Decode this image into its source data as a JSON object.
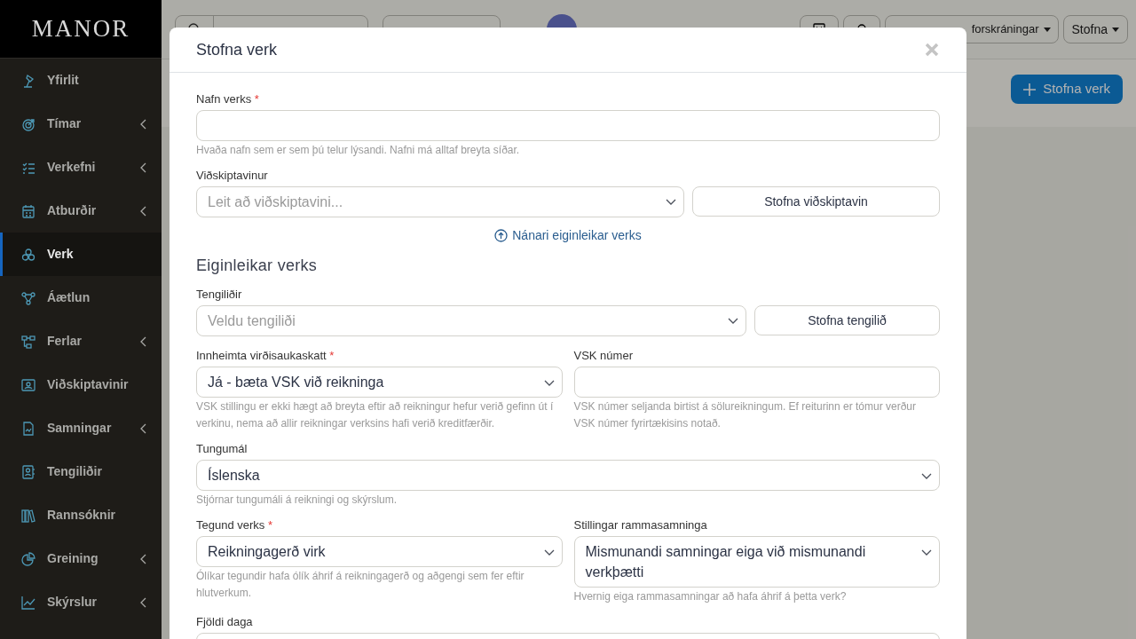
{
  "sidebar": {
    "logo": "MANOR",
    "items": [
      {
        "label": "Yfirlit",
        "selected": false,
        "expandable": false
      },
      {
        "label": "Tímar",
        "selected": false,
        "expandable": true
      },
      {
        "label": "Verkefni",
        "selected": false,
        "expandable": true
      },
      {
        "label": "Atburðir",
        "selected": false,
        "expandable": true
      },
      {
        "label": "Verk",
        "selected": true,
        "expandable": false
      },
      {
        "label": "Áætlun",
        "selected": false,
        "expandable": false
      },
      {
        "label": "Ferlar",
        "selected": false,
        "expandable": true
      },
      {
        "label": "Viðskiptavinir",
        "selected": false,
        "expandable": false
      },
      {
        "label": "Samningar",
        "selected": false,
        "expandable": true
      },
      {
        "label": "Tengiliðir",
        "selected": false,
        "expandable": false
      },
      {
        "label": "Rannsóknir",
        "selected": false,
        "expandable": false
      },
      {
        "label": "Greining",
        "selected": false,
        "expandable": true
      },
      {
        "label": "Skýrslur",
        "selected": false,
        "expandable": true
      }
    ]
  },
  "topbar": {
    "drafts_button": "forskráningar",
    "create_button": "Stofna"
  },
  "page": {
    "create_button": "Stofna verk"
  },
  "modal": {
    "title": "Stofna verk",
    "rows": [
      {
        "kind": "input",
        "label": "Nafn verks",
        "required_mark": "*",
        "help": "Hvaða nafn sem er sem þú telur lýsandi. Nafni má alltaf breyta síðar."
      },
      {
        "kind": "combo",
        "label": "Viðskiptavinur",
        "placeholder": "Leit að viðskiptavini...",
        "button": "Stofna viðskiptavin"
      },
      {
        "kind": "link",
        "text": "Nánari eiginleikar verks"
      },
      {
        "kind": "heading",
        "text": "Eiginleikar verks"
      },
      {
        "kind": "combo",
        "label": "Tengiliðir",
        "placeholder": "Veldu tengiliði",
        "button": "Stofna tengilið"
      },
      {
        "kind": "pair",
        "fields": [
          {
            "kind": "select",
            "label": "Innheimta virðisaukaskatt",
            "required_mark": "*",
            "value": "Já - bæta VSK við reikninga",
            "help": "VSK stillingu er ekki hægt að breyta eftir að reikningur hefur verið gefinn út í verkinu, nema að allir reikningar verksins hafi verið kreditfærðir."
          },
          {
            "kind": "input",
            "label": "VSK númer",
            "help": "VSK númer seljanda birtist á sölureikningum. Ef reiturinn er tómur verður VSK númer fyrirtækisins notað."
          }
        ]
      },
      {
        "kind": "select",
        "label": "Tungumál",
        "value": "Íslenska",
        "help": "Stjórnar tungumáli á reikningi og skýrslum."
      },
      {
        "kind": "pair",
        "fields": [
          {
            "kind": "select",
            "label": "Tegund verks",
            "required_mark": "*",
            "value": "Reikningagerð virk",
            "help": "Ólíkar tegundir hafa ólík áhrif á reikningagerð og aðgengi sem fer eftir hlutverkum."
          },
          {
            "kind": "select",
            "label": "Stillingar rammasamninga",
            "value": "Mismunandi samningar eiga við mismunandi verkþætti",
            "help": "Hvernig eiga rammasamningar að hafa áhrif á þetta verk?"
          }
        ]
      },
      {
        "kind": "input",
        "label": "Fjöldi daga"
      }
    ]
  }
}
